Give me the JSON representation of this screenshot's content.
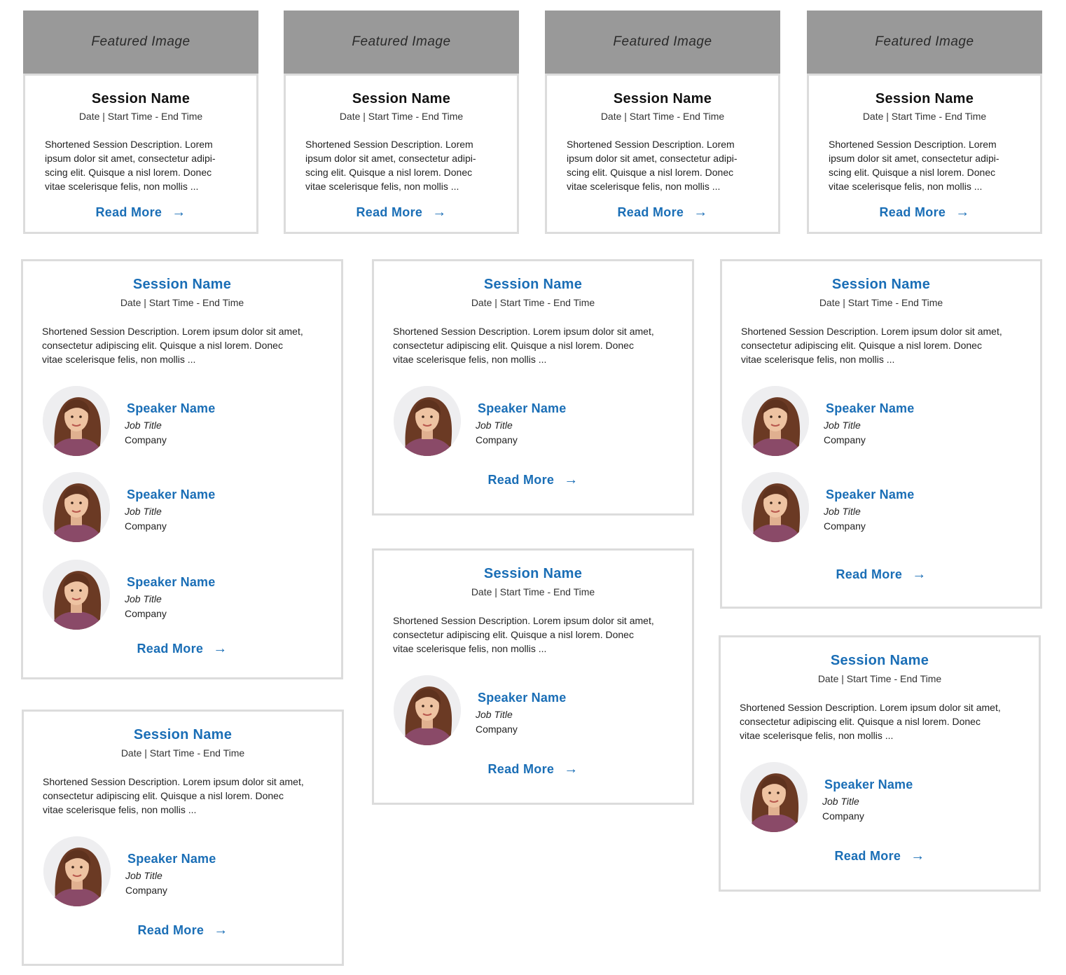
{
  "featured_cards": [
    {
      "image_label": "Featured Image",
      "title": "Session Name",
      "meta": "Date | Start Time - End Time",
      "desc": [
        "Shortened Session Description. Lorem",
        "ipsum dolor sit amet, consectetur adipi-",
        "scing elit. Quisque a nisl lorem. Donec",
        "vitae scelerisque felis, non mollis ..."
      ],
      "read_more": "Read More",
      "arrow": "→"
    },
    {
      "image_label": "Featured Image",
      "title": "Session Name",
      "meta": "Date | Start Time - End Time",
      "desc": [
        "Shortened Session Description. Lorem",
        "ipsum dolor sit amet, consectetur adipi-",
        "scing elit. Quisque a nisl lorem. Donec",
        "vitae scelerisque felis, non mollis ..."
      ],
      "read_more": "Read More",
      "arrow": "→"
    },
    {
      "image_label": "Featured Image",
      "title": "Session Name",
      "meta": "Date | Start Time - End Time",
      "desc": [
        "Shortened Session Description. Lorem",
        "ipsum dolor sit amet, consectetur adipi-",
        "scing elit. Quisque a nisl lorem. Donec",
        "vitae scelerisque felis, non mollis ..."
      ],
      "read_more": "Read More",
      "arrow": "→"
    },
    {
      "image_label": "Featured Image",
      "title": "Session Name",
      "meta": "Date | Start Time - End Time",
      "desc": [
        "Shortened Session Description. Lorem",
        "ipsum dolor sit amet, consectetur adipi-",
        "scing elit. Quisque a nisl lorem. Donec",
        "vitae scelerisque felis, non mollis ..."
      ],
      "read_more": "Read More",
      "arrow": "→"
    }
  ],
  "speaker_cards": [
    {
      "title": "Session Name",
      "meta": "Date | Start Time - End Time",
      "desc": [
        "Shortened Session Description. Lorem ipsum dolor sit amet,",
        "consectetur adipiscing elit. Quisque a nisl lorem. Donec",
        "vitae scelerisque felis, non mollis ..."
      ],
      "speakers": [
        {
          "name": "Speaker Name",
          "job": "Job Title",
          "company": "Company"
        },
        {
          "name": "Speaker Name",
          "job": "Job Title",
          "company": "Company"
        },
        {
          "name": "Speaker Name",
          "job": "Job Title",
          "company": "Company"
        }
      ],
      "read_more": "Read More",
      "arrow": "→"
    },
    {
      "title": "Session Name",
      "meta": "Date | Start Time - End Time",
      "desc": [
        "Shortened Session Description. Lorem ipsum dolor sit amet,",
        "consectetur adipiscing elit. Quisque a nisl lorem. Donec",
        "vitae scelerisque felis, non mollis ..."
      ],
      "speakers": [
        {
          "name": "Speaker Name",
          "job": "Job Title",
          "company": "Company"
        }
      ],
      "read_more": "Read More",
      "arrow": "→"
    },
    {
      "title": "Session Name",
      "meta": "Date | Start Time - End Time",
      "desc": [
        "Shortened Session Description. Lorem ipsum dolor sit amet,",
        "consectetur adipiscing elit. Quisque a nisl lorem. Donec",
        "vitae scelerisque felis, non mollis ..."
      ],
      "speakers": [
        {
          "name": "Speaker Name",
          "job": "Job Title",
          "company": "Company"
        },
        {
          "name": "Speaker Name",
          "job": "Job Title",
          "company": "Company"
        }
      ],
      "read_more": "Read More",
      "arrow": "→"
    },
    {
      "title": "Session Name",
      "meta": "Date | Start Time - End Time",
      "desc": [
        "Shortened Session Description. Lorem ipsum dolor sit amet,",
        "consectetur adipiscing elit. Quisque a nisl lorem. Donec",
        "vitae scelerisque felis, non mollis ..."
      ],
      "speakers": [
        {
          "name": "Speaker Name",
          "job": "Job Title",
          "company": "Company"
        }
      ],
      "read_more": "Read More",
      "arrow": "→"
    },
    {
      "title": "Session Name",
      "meta": "Date | Start Time - End Time",
      "desc": [
        "Shortened Session Description. Lorem ipsum dolor sit amet,",
        "consectetur adipiscing elit. Quisque a nisl lorem. Donec",
        "vitae scelerisque felis, non mollis ..."
      ],
      "speakers": [
        {
          "name": "Speaker Name",
          "job": "Job Title",
          "company": "Company"
        }
      ],
      "read_more": "Read More",
      "arrow": "→"
    },
    {
      "title": "Session Name",
      "meta": "Date | Start Time - End Time",
      "desc": [
        "Shortened Session Description. Lorem ipsum dolor sit amet,",
        "consectetur adipiscing elit. Quisque a nisl lorem. Donec",
        "vitae scelerisque felis, non mollis ..."
      ],
      "speakers": [
        {
          "name": "Speaker Name",
          "job": "Job Title",
          "company": "Company"
        }
      ],
      "read_more": "Read More",
      "arrow": "→"
    }
  ],
  "colors": {
    "accent": "#1a6eb6",
    "border": "#dcdcdc",
    "image_placeholder": "#999999"
  }
}
